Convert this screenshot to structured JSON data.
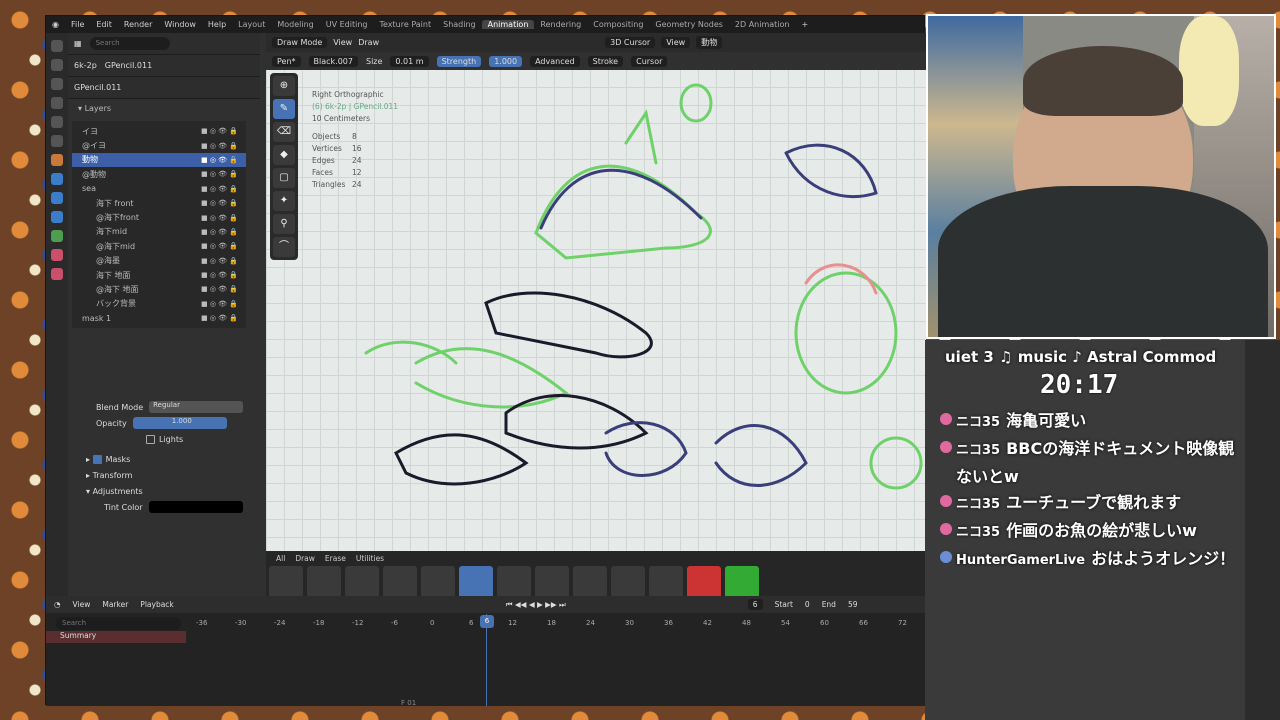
{
  "topbar": {
    "menus": [
      "File",
      "Edit",
      "Render",
      "Window",
      "Help"
    ],
    "workspaces": [
      "Layout",
      "Modeling",
      "UV Editing",
      "Texture Paint",
      "Shading",
      "Animation",
      "Rendering",
      "Compositing",
      "Geometry Nodes",
      "2D Animation"
    ],
    "active": "Animation"
  },
  "outliner": {
    "search_placeholder": "Search",
    "object": "6k-2p",
    "gp": "GPencil.011",
    "data_name": "GPencil.011",
    "layers_title": "Layers",
    "layers": [
      {
        "name": "イヨ"
      },
      {
        "name": "@イヨ"
      },
      {
        "name": "動物",
        "selected": true
      },
      {
        "name": "@動物"
      },
      {
        "name": "sea"
      },
      {
        "name": "海下 front"
      },
      {
        "name": "@海下front"
      },
      {
        "name": "海下mid"
      },
      {
        "name": "@海下mid"
      },
      {
        "name": "@海墨"
      },
      {
        "name": "海下 地面"
      },
      {
        "name": "@海下 地面"
      },
      {
        "name": "バック背景"
      },
      {
        "name": "mask 1"
      }
    ]
  },
  "props": {
    "blend_label": "Blend Mode",
    "blend_value": "Regular",
    "opacity_label": "Opacity",
    "opacity_value": "1.000",
    "lights_label": "Lights",
    "masks": "Masks",
    "transform": "Transform",
    "adjustments": "Adjustments",
    "tint": "Tint Color"
  },
  "viewport": {
    "mode": "Draw Mode",
    "view": "View",
    "draw": "Draw",
    "cursor": "3D Cursor",
    "view2": "View",
    "coll": "動物",
    "brush": "Pen*",
    "material": "Black.007",
    "size_label": "Size",
    "size_value": "0.01 m",
    "strength_label": "Strength",
    "strength_value": "1.000",
    "advanced": "Advanced",
    "stroke": "Stroke",
    "cursor2": "Cursor",
    "info_view": "Right Orthographic",
    "info_obj": "(6) 6k-2p | GPencil.011",
    "info_scale": "10 Centimeters",
    "stats": [
      {
        "k": "Objects",
        "v": "8"
      },
      {
        "k": "Vertices",
        "v": "16"
      },
      {
        "k": "Edges",
        "v": "24"
      },
      {
        "k": "Faces",
        "v": "12"
      },
      {
        "k": "Triangles",
        "v": "24"
      }
    ]
  },
  "brushbar": {
    "tabs": [
      "All",
      "Draw",
      "Erase",
      "Utilities"
    ]
  },
  "timeline": {
    "view": "View",
    "marker": "Marker",
    "playback": "Playback",
    "search": "Search",
    "summary": "Summary",
    "frame": "6",
    "start_label": "Start",
    "start": "0",
    "end_label": "End",
    "end": "59",
    "ticks": [
      "-36",
      "-30",
      "-24",
      "-18",
      "-12",
      "-6",
      "0",
      "6",
      "12",
      "18",
      "24",
      "30",
      "36",
      "42",
      "48",
      "54",
      "60",
      "66",
      "72"
    ],
    "footer": "F 01"
  },
  "stream": {
    "music": "uiet 3   ♫ music ♪ Astral Commod",
    "clock": "20:17",
    "chat": [
      {
        "user": "ニコ35",
        "text": "海亀可愛い"
      },
      {
        "user": "ニコ35",
        "text": "BBCの海洋ドキュメント映像観ないとw"
      },
      {
        "user": "ニコ35",
        "text": "ユーチューブで観れます"
      },
      {
        "user": "ニコ35",
        "text": "作画のお魚の絵が悲しいw"
      },
      {
        "user": "HunterGamerLive",
        "text": "おはようオレンジ！"
      }
    ]
  },
  "colors": {
    "accent": "#4772b3",
    "stroke_green": "#6fd16a",
    "stroke_dark": "#1a1a2a"
  }
}
